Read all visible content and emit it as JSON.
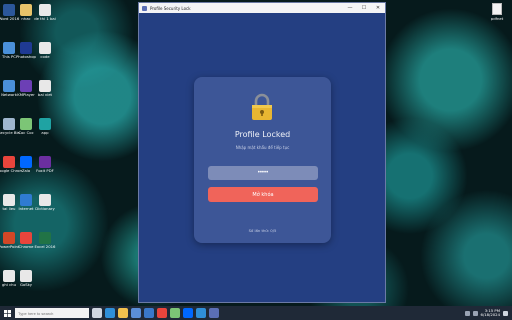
{
  "desktop": {
    "icons": [
      {
        "label": "Word 2016",
        "color": "#2b579a"
      },
      {
        "label": "nhac",
        "color": "#e8c36a"
      },
      {
        "label": "de thi 1 bai",
        "color": "#e8e8e8"
      },
      {
        "label": "This PC",
        "color": "#4a90d9"
      },
      {
        "label": "Photoshop",
        "color": "#1f3a93"
      },
      {
        "label": "code",
        "color": "#e8e8e8"
      },
      {
        "label": "Network",
        "color": "#4a90d9"
      },
      {
        "label": "KMPlayer",
        "color": "#6c3fb5"
      },
      {
        "label": "bai viet",
        "color": "#e8e8e8"
      },
      {
        "label": "Recycle Bin",
        "color": "#9fb7cf"
      },
      {
        "label": "Coc Coc",
        "color": "#7cc576"
      },
      {
        "label": "app",
        "color": "#1fa3a3"
      },
      {
        "label": "Google Chrome",
        "color": "#e8453c"
      },
      {
        "label": "Zalo",
        "color": "#0068ff"
      },
      {
        "label": "Foxit PDF",
        "color": "#6b2fa0"
      },
      {
        "label": "tai lieu",
        "color": "#e8e8e8"
      },
      {
        "label": "Internet",
        "color": "#2f7bd1"
      },
      {
        "label": "Dictionary",
        "color": "#e8e8e8"
      },
      {
        "label": "PowerPoint",
        "color": "#d24726"
      },
      {
        "label": "Chrome",
        "color": "#e8453c"
      },
      {
        "label": "Excel 2016",
        "color": "#217346"
      },
      {
        "label": "ghi chu",
        "color": "#e8e8e8"
      },
      {
        "label": "GoSky",
        "color": "#e8e8e8"
      }
    ],
    "right_icon": {
      "label": "pdfnet"
    }
  },
  "window": {
    "title": "Profile Security Lock",
    "minimize": "—",
    "maximize": "☐",
    "close": "✕"
  },
  "lock_screen": {
    "title": "Profile Locked",
    "subtitle": "Nhập mật khẩu để tiếp tục",
    "password_value": "•••••",
    "unlock_label": "Mở khóa",
    "attempts_text": "Số lần thử: 0/5"
  },
  "taskbar": {
    "search_placeholder": "Type here to search",
    "apps": [
      {
        "name": "task-view",
        "color": "#cfd6e0"
      },
      {
        "name": "edge",
        "color": "#2f8fd8"
      },
      {
        "name": "file-explorer",
        "color": "#f2c14e"
      },
      {
        "name": "store",
        "color": "#5b8ed8"
      },
      {
        "name": "mail",
        "color": "#3a78c9"
      },
      {
        "name": "chrome",
        "color": "#e8453c"
      },
      {
        "name": "coc-coc",
        "color": "#7cc576"
      },
      {
        "name": "zalo",
        "color": "#0068ff"
      },
      {
        "name": "vscode",
        "color": "#2f8fd8"
      },
      {
        "name": "profile-lock",
        "color": "#5b6fb6"
      }
    ],
    "time": "3:15 PM",
    "date": "6/18/2024"
  }
}
